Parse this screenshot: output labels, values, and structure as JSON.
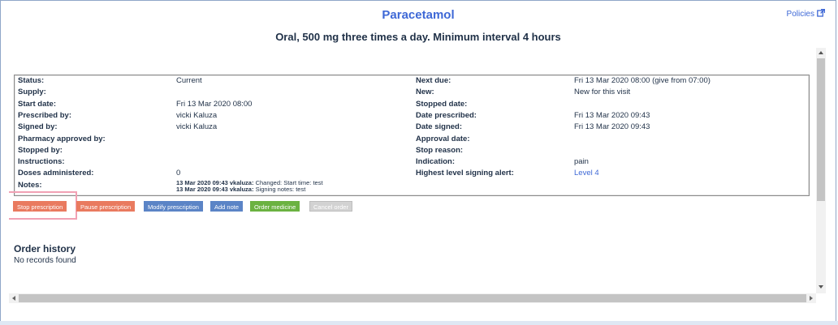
{
  "header": {
    "title": "Paracetamol",
    "subtitle": "Oral, 500 mg three times a day. Minimum interval 4 hours",
    "policies_link": "Policies",
    "link_color": "#3e68d6"
  },
  "details_left": [
    {
      "label": "Status:",
      "value": "Current"
    },
    {
      "label": "Supply:",
      "value": ""
    },
    {
      "label": "Start date:",
      "value": "Fri 13 Mar 2020 08:00"
    },
    {
      "label": "Prescribed by:",
      "value": "vicki Kaluza"
    },
    {
      "label": "Signed by:",
      "value": "vicki Kaluza"
    },
    {
      "label": "Pharmacy approved by:",
      "value": ""
    },
    {
      "label": "Stopped by:",
      "value": ""
    },
    {
      "label": "Instructions:",
      "value": ""
    },
    {
      "label": "Doses administered:",
      "value": "0"
    }
  ],
  "details_right": [
    {
      "label": "Next due:",
      "value": "Fri 13 Mar 2020 08:00 (give from 07:00)"
    },
    {
      "label": "New:",
      "value": "New for this visit"
    },
    {
      "label": "Stopped date:",
      "value": ""
    },
    {
      "label": "Date prescribed:",
      "value": "Fri 13 Mar 2020 09:43"
    },
    {
      "label": "Date signed:",
      "value": "Fri 13 Mar 2020 09:43"
    },
    {
      "label": "Approval date:",
      "value": ""
    },
    {
      "label": "Stop reason:",
      "value": ""
    },
    {
      "label": "Indication:",
      "value": "pain"
    },
    {
      "label": "Highest level signing alert:",
      "value": "Level 4"
    }
  ],
  "notes": {
    "label": "Notes:",
    "entries": [
      {
        "stamp": "13 Mar 2020 09:43 vkaluza:",
        "text": "Changed: Start time: test"
      },
      {
        "stamp": "13 Mar 2020 09:43 vkaluza:",
        "text": "Signing notes: test"
      }
    ]
  },
  "actions": {
    "stop": "Stop prescription",
    "pause": "Pause prescription",
    "modify": "Modify prescription",
    "add_note": "Add note",
    "order": "Order medicine",
    "cancel": "Cancel order"
  },
  "order_history": {
    "title": "Order history",
    "empty": "No records found"
  },
  "colors": {
    "orange": "#e97a5f",
    "blue": "#5b84c6",
    "green": "#6bb241",
    "highlight": "#f1a1b4"
  }
}
